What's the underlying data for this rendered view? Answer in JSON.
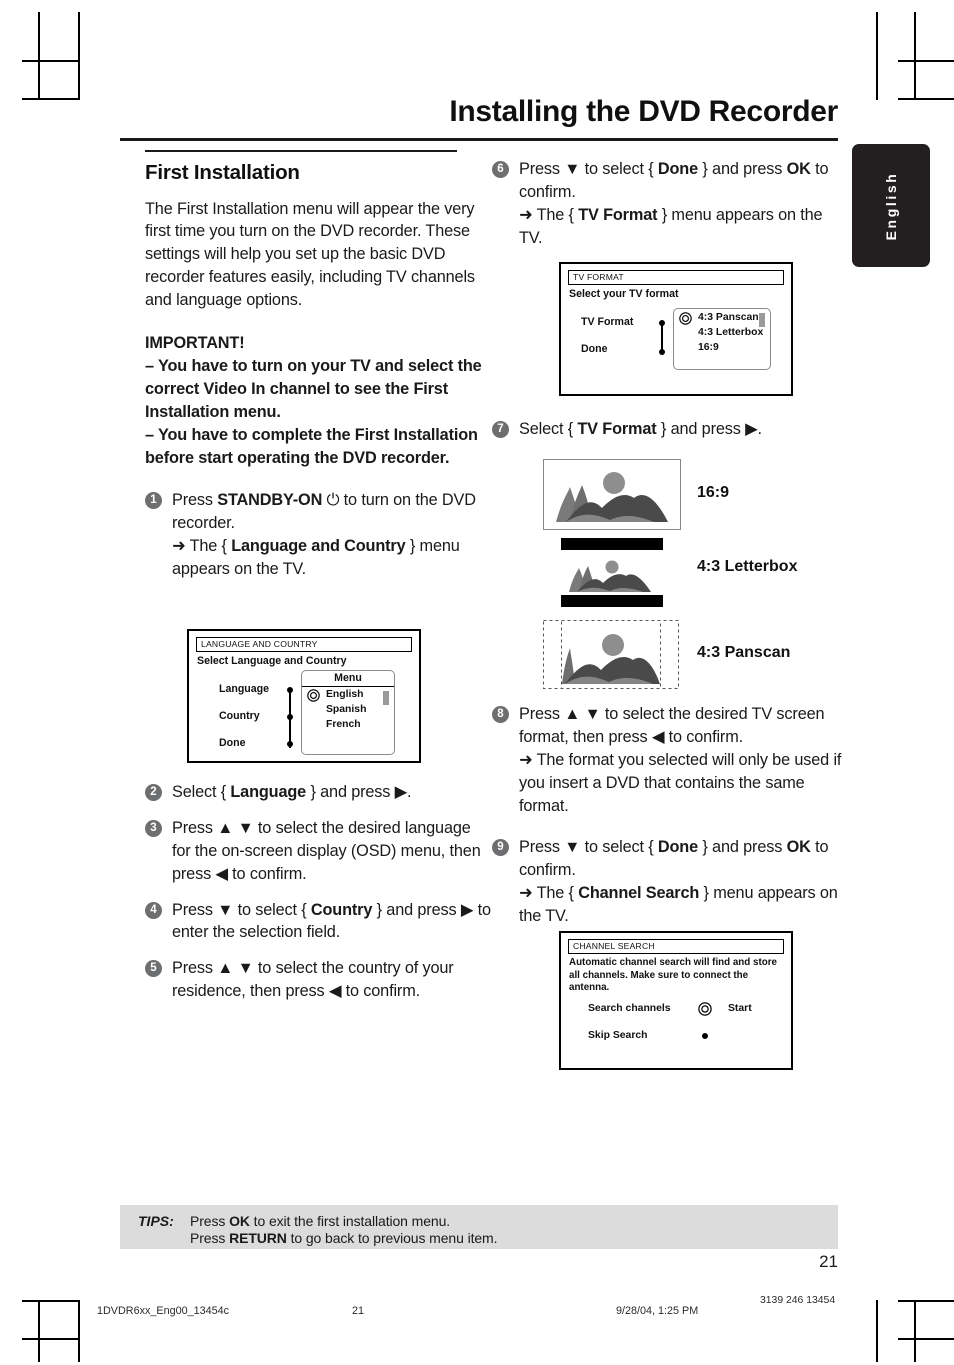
{
  "header": {
    "title": "Installing the DVD Recorder",
    "language_tab": "English"
  },
  "left_column": {
    "section_title": "First Installation",
    "intro": "The First Installation menu will appear the very first time you turn on the DVD recorder.  These settings will help you set up the basic DVD recorder features easily, including TV channels and language options.",
    "important_heading": "IMPORTANT!",
    "important_1": "–  You have to turn on your TV and select the correct Video In channel to see the First Installation menu.",
    "important_2": "–  You have to complete the First Installation before start operating the DVD recorder.",
    "steps": [
      {
        "number": "1",
        "line1_pre": "Press ",
        "line1_bold": "STANDBY-ON",
        "line1_post": " ⏻  to turn on the DVD recorder.",
        "result_pre": "The { ",
        "result_bold": "Language and Country",
        "result_post": " } menu appears on the TV."
      },
      {
        "number": "2",
        "line1_pre": "Select { ",
        "line1_bold": "Language",
        "line1_post": " } and press ▶."
      },
      {
        "number": "3",
        "line1_pre": "Press ▲ ▼ to select the desired language for the on-screen display (OSD) menu, then press ◀ to confirm."
      },
      {
        "number": "4",
        "line1_pre": "Press ▼ to select { ",
        "line1_bold": "Country",
        "line1_post": " } and press ▶  to enter the selection field."
      },
      {
        "number": "5",
        "line1_pre": "Press ▲ ▼ to select the country of your residence, then press ◀ to confirm."
      }
    ]
  },
  "right_column": {
    "steps": [
      {
        "number": "6",
        "line1_pre": "Press ▼ to select { ",
        "line1_bold": "Done",
        "line1_post": " } and press ",
        "line1_bold2": "OK",
        "line1_tail": " to confirm.",
        "result_pre": "The { ",
        "result_bold": "TV Format",
        "result_post": " } menu appears on the TV."
      },
      {
        "number": "7",
        "line1_pre": "Select { ",
        "line1_bold": "TV Format",
        "line1_post": " } and press ▶."
      },
      {
        "number": "8",
        "line1_pre": "Press ▲ ▼ to select the desired TV screen format, then press ◀ to confirm.",
        "result_pre": "The format you selected will only be used if you insert a DVD that contains the same format."
      },
      {
        "number": "9",
        "line1_pre": "Press ▼ to select { ",
        "line1_bold": "Done",
        "line1_post": " } and press ",
        "line1_bold2": "OK",
        "line1_tail": " to confirm.",
        "result_pre": "The { ",
        "result_bold": "Channel Search",
        "result_post": " } menu appears on the TV."
      }
    ]
  },
  "osd_language_country": {
    "title": "LANGUAGE AND COUNTRY",
    "subtitle": "Select Language and Country",
    "rows": [
      "Language",
      "Country",
      "Done"
    ],
    "panel_header": "Menu",
    "options": [
      "English",
      "Spanish",
      "French"
    ],
    "selected_option": "English"
  },
  "osd_tv_format": {
    "title": "TV FORMAT",
    "subtitle": "Select your TV format",
    "rows": [
      "TV Format",
      "Done"
    ],
    "options": [
      "4:3 Panscan",
      "4:3 Letterbox",
      "16:9"
    ],
    "selected_option": "4:3 Panscan"
  },
  "osd_channel_search": {
    "title": "CHANNEL SEARCH",
    "description": "Automatic channel search will find and store all channels.  Make sure to connect the antenna.",
    "row1_label": "Search channels",
    "row1_value": "Start",
    "row2_label": "Skip Search"
  },
  "tv_formats": [
    {
      "label": "16:9",
      "kind": "widescreen"
    },
    {
      "label": "4:3  Letterbox",
      "kind": "letterbox"
    },
    {
      "label": "4:3 Panscan",
      "kind": "panscan"
    }
  ],
  "tips": {
    "label": "TIPS:",
    "line1_pre": "Press ",
    "line1_bold": "OK",
    "line1_post": " to exit the first installation menu.",
    "line2_pre": "Press ",
    "line2_bold": "RETURN",
    "line2_post": " to go back to previous menu item."
  },
  "page_number": "21",
  "print_footer": {
    "file": "1DVDR6xx_Eng00_13454c",
    "page": "21",
    "date": "9/28/04, 1:25 PM",
    "code": "3139 246 13454"
  },
  "colors": {
    "step_badge": "#6d6e70",
    "tab_background": "#231f20",
    "tips_background": "#dcdcdc",
    "text": "#1a1a1a"
  }
}
